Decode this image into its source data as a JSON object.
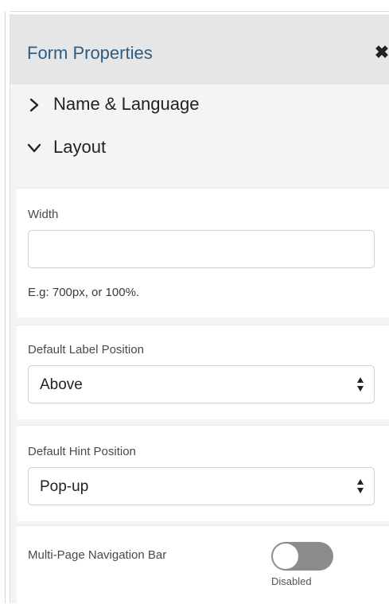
{
  "panel": {
    "title": "Form Properties",
    "close_label": "✖"
  },
  "accordion": [
    {
      "label": "Name & Language",
      "expanded": false
    },
    {
      "label": "Layout",
      "expanded": true
    }
  ],
  "fields": {
    "width": {
      "label": "Width",
      "value": "",
      "placeholder": "",
      "hint": "E.g: 700px, or 100%."
    },
    "label_position": {
      "label": "Default Label Position",
      "selected": "Above"
    },
    "hint_position": {
      "label": "Default Hint Position",
      "selected": "Pop-up"
    },
    "nav_bar": {
      "label": "Multi-Page Navigation Bar",
      "enabled": false,
      "state_label": "Disabled"
    }
  },
  "colors": {
    "title": "#2f5c82",
    "panel_bg": "#f4f4f4",
    "header_bg": "#e6e6e6",
    "toggle_off": "#8c8c8c"
  }
}
